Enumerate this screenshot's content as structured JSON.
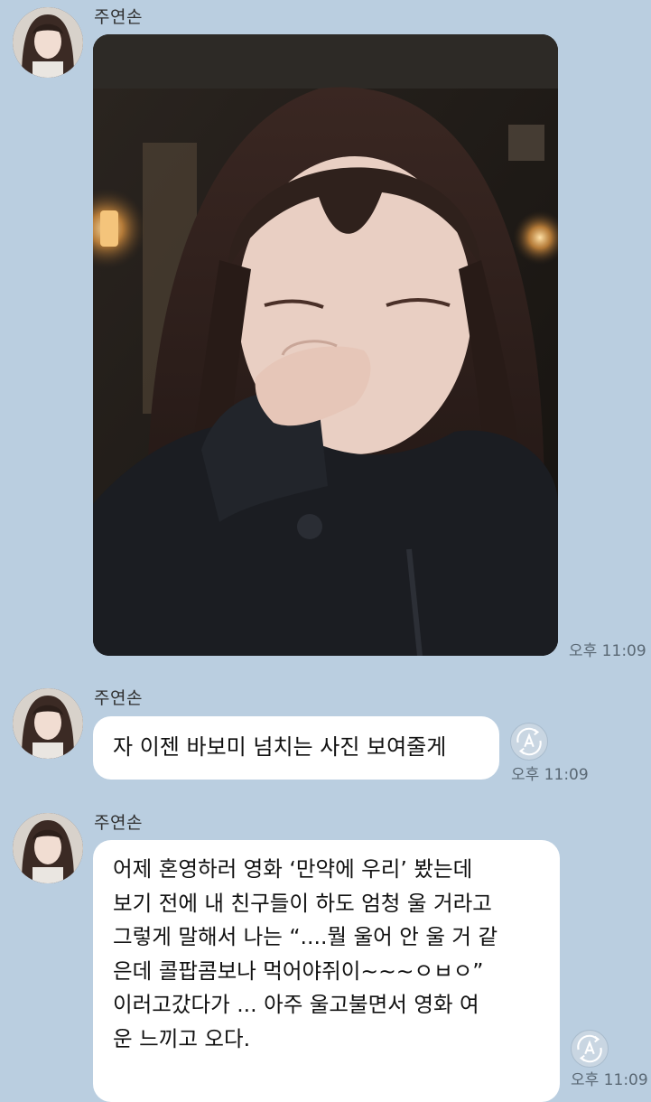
{
  "messages": [
    {
      "sender": "주연손",
      "type": "photo",
      "time": "오후 11:09"
    },
    {
      "sender": "주연손",
      "type": "text",
      "text": "자 이젠 바보미 넘치는 사진 보여줄게",
      "time": "오후 11:09"
    },
    {
      "sender": "주연손",
      "type": "text",
      "text": "어제 혼영하러 영화 ‘만약에 우리’ 봤는데\n보기 전에 내 친구들이 하도 엄청 울 거라고\n그렇게 말해서 나는 “....뭘 울어 안 울 거 같\n은데 콜팝콤보나 먹어야쥐이~~~ㅇㅂㅇ”\n이러고갔다가 ... 아주 울고불면서 영화 여\n운 느끼고 오다.",
      "time": "오후 11:09"
    }
  ],
  "icons": {
    "avatar": "profile-photo",
    "translate": "translate-icon"
  },
  "colors": {
    "background": "#bacee0",
    "bubble": "#ffffff",
    "time": "#5a6874"
  }
}
